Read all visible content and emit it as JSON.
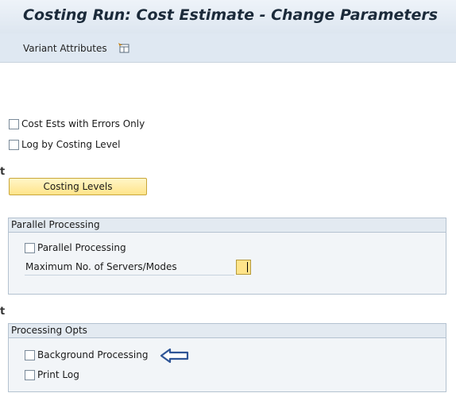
{
  "window": {
    "title": "Costing Run: Cost Estimate - Change Parameters"
  },
  "toolbar": {
    "variant_attributes_label": "Variant Attributes",
    "variant_attributes_icon": "variant-attributes-icon"
  },
  "options": {
    "errors_only_label": "Cost Ests with Errors Only",
    "errors_only_checked": false,
    "log_by_level_label": "Log by Costing Level",
    "log_by_level_checked": false,
    "costing_levels_button": "Costing Levels"
  },
  "parallel_processing": {
    "group_title": "Parallel Processing",
    "checkbox_label": "Parallel Processing",
    "checkbox_checked": false,
    "max_servers_label": "Maximum No. of Servers/Modes",
    "max_servers_value": ""
  },
  "processing_opts": {
    "group_title": "Processing Opts",
    "background_label": "Background Processing",
    "background_checked": false,
    "print_log_label": "Print Log",
    "print_log_checked": false
  },
  "annotation": {
    "arrow_icon": "left-arrow-icon",
    "arrow_color": "#2f5597"
  },
  "colors": {
    "button_fill": "#ffe48a",
    "group_header": "#e3eaf1",
    "title_text": "#1b2a3a"
  }
}
